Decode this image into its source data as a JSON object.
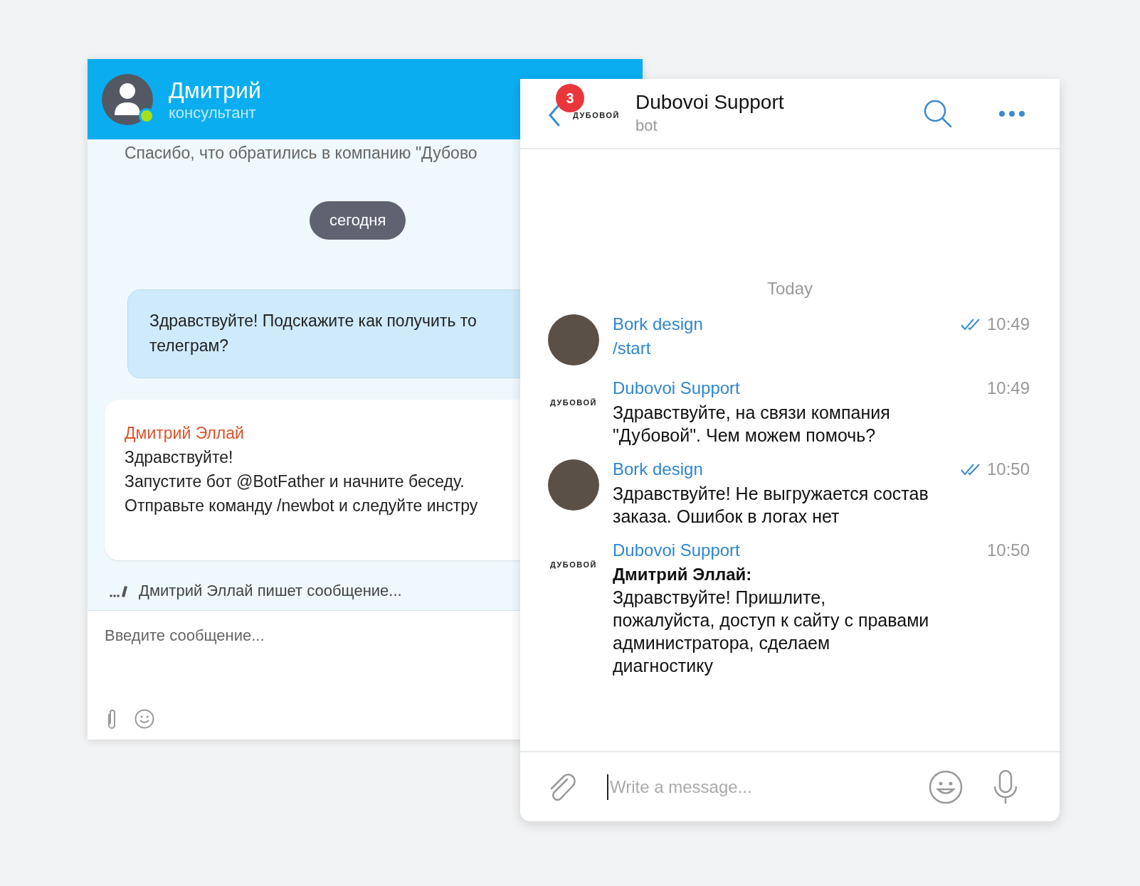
{
  "widget": {
    "header": {
      "name": "Дмитрий",
      "role": "консультант",
      "online": true
    },
    "intro": "Спасибо, что обратились в компанию \"Дубово",
    "date_pill": "сегодня",
    "messages": [
      {
        "kind": "outgoing",
        "lines": [
          "Здравствуйте! Подскажите как получить то",
          "телеграм?"
        ]
      },
      {
        "kind": "incoming",
        "author": "Дмитрий Эллай",
        "lines": [
          "Здравствуйте!",
          "Запустите бот @BotFather и начните беседу.",
          "Отправьте команду /newbot и следуйте инстру"
        ]
      }
    ],
    "typing": "Дмитрий Эллай пишет сообщение...",
    "input": {
      "placeholder": "Введите сообщение..."
    }
  },
  "telegram": {
    "header": {
      "badge": "3",
      "logo": "ДУБОВОЙ",
      "title": "Dubovoi Support",
      "subtitle": "bot"
    },
    "date": "Today",
    "messages": [
      {
        "sender": "Bork design",
        "time": "10:49",
        "read": true,
        "kind": "command",
        "text": "/start"
      },
      {
        "sender": "Dubovoi Support",
        "logo": "ДУБОВОЙ",
        "time": "10:49",
        "read": false,
        "kind": "text",
        "text": "Здравствуйте, на связи компания \"Дубовой\". Чем можем помочь?"
      },
      {
        "sender": "Bork design",
        "time": "10:50",
        "read": true,
        "kind": "text",
        "text": "Здравствуйте! Не выгружается состав заказа. Ошибок в логах нет"
      },
      {
        "sender": "Dubovoi Support",
        "logo": "ДУБОВОЙ",
        "time": "10:50",
        "read": false,
        "kind": "text",
        "author": "Дмитрий Эллай:",
        "text": "Здравствуйте! Пришлите, пожалуйста, доступ к сайту с правами администратора, сделаем диагностику"
      }
    ],
    "input": {
      "placeholder": "Write a message..."
    }
  }
}
